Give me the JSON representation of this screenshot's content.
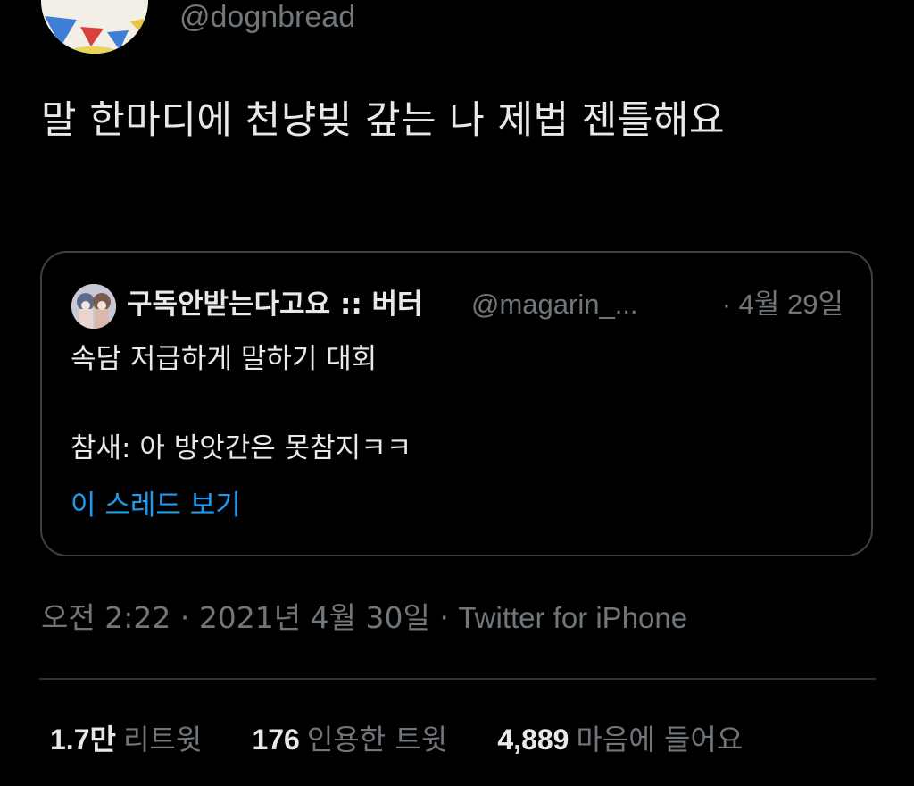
{
  "author": {
    "handle": "@dognbread"
  },
  "tweet": {
    "text": "말 한마디에 천냥빚 갚는 나 제법 젠틀해요"
  },
  "quoted_tweet": {
    "name": "구독안받는다고요 :: 버터",
    "handle": "@magarin_...",
    "date": "· 4월 29일",
    "line1": "속담 저급하게 말하기 대회",
    "line2": "참새: 아 방앗간은 못참지ㅋㅋ",
    "show_thread": "이 스레드 보기"
  },
  "meta": {
    "time": "오전 2:22",
    "separator": " · ",
    "date": "2021년 4월 30일",
    "source": "Twitter for iPhone"
  },
  "stats": {
    "retweets_count": "1.7만",
    "retweets_label": "리트윗",
    "quotes_count": "176",
    "quotes_label": "인용한 트윗",
    "likes_count": "4,889",
    "likes_label": "마음에 들어요"
  },
  "colors": {
    "background": "#000000",
    "text": "#e7e9ea",
    "secondary": "#71767b",
    "link": "#1d9bf0",
    "border": "#3d4145"
  }
}
